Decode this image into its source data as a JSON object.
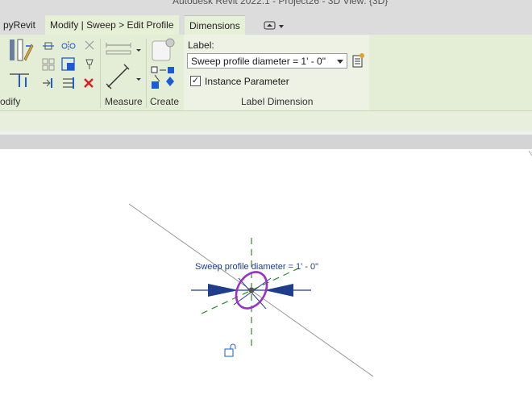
{
  "window": {
    "title": "Autodesk Revit 2022.1 - Project26 - 3D View: {3D}"
  },
  "tabs": [
    {
      "label": "pyRevit"
    },
    {
      "label": "Modify | Sweep > Edit Profile"
    },
    {
      "label": "Dimensions"
    }
  ],
  "panels": {
    "modify": "odify",
    "measure": "Measure",
    "create": "Create",
    "label_dimension": "Label Dimension"
  },
  "label_dimension": {
    "label_caption": "Label:",
    "selected_label": "Sweep profile diameter = 1' - 0\"",
    "instance_parameter_label": "Instance Parameter",
    "instance_parameter_checked": true,
    "check_glyph": "✓"
  },
  "canvas": {
    "dimension_text": "Sweep profile diameter = 1' - 0\""
  },
  "colors": {
    "ribbon": "#e4edd5",
    "dimension_blue": "#1f3d8a",
    "profile_purple": "#9b30c8",
    "reference_green": "#2e8b2e",
    "selection_blue": "#1a5bd6"
  }
}
